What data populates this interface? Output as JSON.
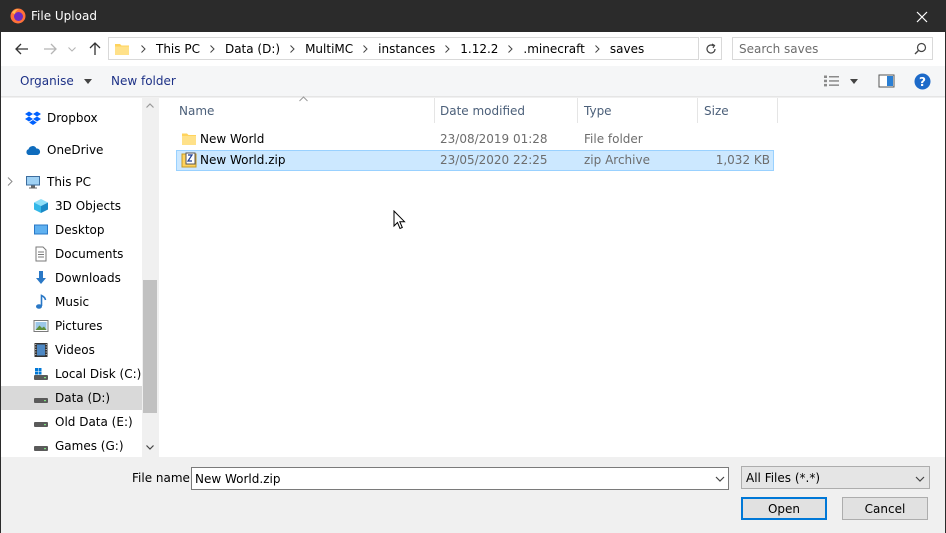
{
  "window": {
    "title": "File Upload"
  },
  "address": {
    "breadcrumbs": [
      "This PC",
      "Data (D:)",
      "MultiMC",
      "instances",
      "1.12.2",
      ".minecraft",
      "saves"
    ]
  },
  "search": {
    "placeholder": "Search saves"
  },
  "toolbar": {
    "organise_label": "Organise",
    "new_folder_label": "New folder"
  },
  "sidebar": {
    "items": [
      {
        "label": "Dropbox",
        "icon": "dropbox-icon"
      },
      {
        "label": "OneDrive",
        "icon": "onedrive-icon"
      },
      {
        "label": "This PC",
        "icon": "computer-icon"
      },
      {
        "label": "3D Objects",
        "icon": "cube-icon"
      },
      {
        "label": "Desktop",
        "icon": "desktop-icon"
      },
      {
        "label": "Documents",
        "icon": "documents-icon"
      },
      {
        "label": "Downloads",
        "icon": "downloads-icon"
      },
      {
        "label": "Music",
        "icon": "music-icon"
      },
      {
        "label": "Pictures",
        "icon": "pictures-icon"
      },
      {
        "label": "Videos",
        "icon": "videos-icon"
      },
      {
        "label": "Local Disk (C:)",
        "icon": "drive-icon"
      },
      {
        "label": "Data (D:)",
        "icon": "drive-icon",
        "selected": true
      },
      {
        "label": "Old Data (E:)",
        "icon": "drive-icon"
      },
      {
        "label": "Games (G:)",
        "icon": "drive-icon"
      }
    ]
  },
  "files": {
    "columns": [
      "Name",
      "Date modified",
      "Type",
      "Size"
    ],
    "rows": [
      {
        "name": "New World",
        "date": "23/08/2019 01:28",
        "type": "File folder",
        "size": "",
        "icon": "folder-icon"
      },
      {
        "name": "New World.zip",
        "date": "23/05/2020 22:25",
        "type": "zip Archive",
        "size": "1,032 KB",
        "icon": "zip-icon",
        "selected": true
      }
    ]
  },
  "bottom": {
    "filename_label": "File name:",
    "filename_value": "New World.zip",
    "filetype_value": "All Files (*.*)",
    "open_label": "Open",
    "cancel_label": "Cancel"
  },
  "colors": {
    "accent": "#0078d7",
    "selection": "#cce8ff",
    "titlebar": "#2b2b2b",
    "link": "#1e3287"
  }
}
